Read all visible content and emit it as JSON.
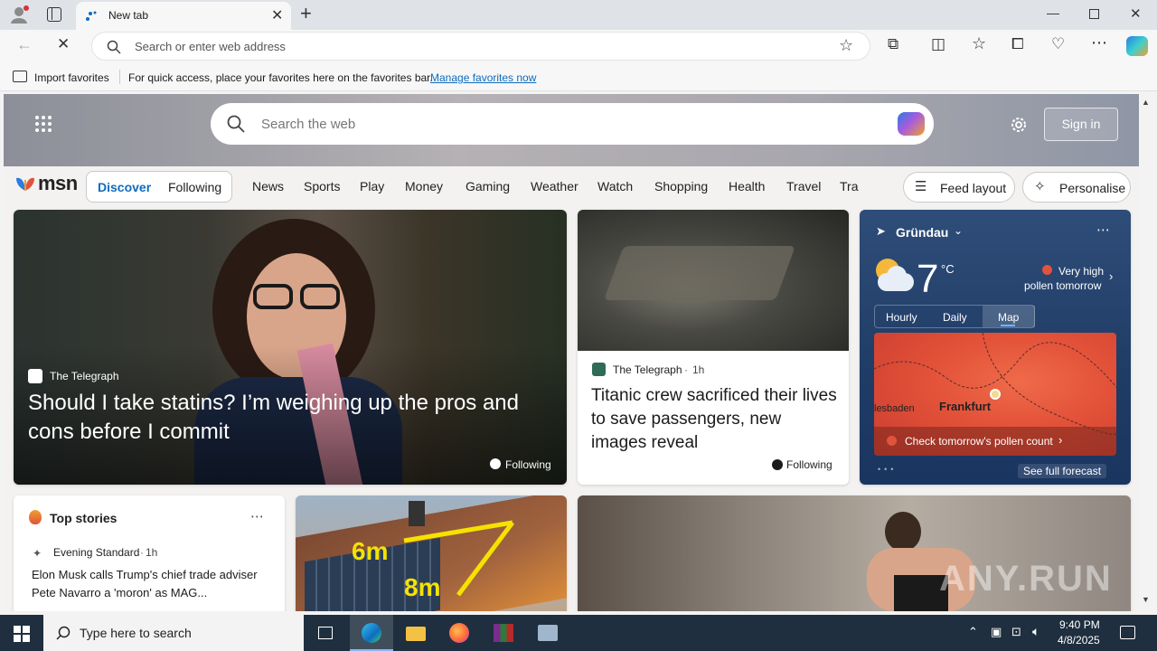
{
  "browser": {
    "tab_title": "New tab",
    "address_placeholder": "Search or enter web address",
    "favorites": {
      "import_label": "Import favorites",
      "hint": "For quick access, place your favorites here on the favorites bar.",
      "manage_link": "Manage favorites now"
    }
  },
  "msn": {
    "search_placeholder": "Search the web",
    "sign_in": "Sign in",
    "logo": "msn",
    "tabs": [
      "Discover",
      "Following"
    ],
    "nav": [
      "News",
      "Sports",
      "Play",
      "Money",
      "Gaming",
      "Weather",
      "Watch",
      "Shopping",
      "Health",
      "Travel",
      "Tra"
    ],
    "feed_layout": "Feed layout",
    "personalise": "Personalise"
  },
  "hero": {
    "source": "The Telegraph",
    "title": "Should I take statins? I’m weighing up the pros and cons before I commit",
    "following": "Following"
  },
  "titanic": {
    "source": "The Telegraph",
    "time": "1h",
    "title": "Titanic crew sacrificed their lives to save passengers, new images reveal",
    "following": "Following"
  },
  "weather": {
    "location": "Gründau",
    "temp": "7",
    "unit": "°C",
    "pollen_line1": "Very high",
    "pollen_line2": "pollen tomorrow",
    "tabs": [
      "Hourly",
      "Daily",
      "Map"
    ],
    "map_labels": [
      "lesbaden",
      "Frankfurt"
    ],
    "pollen_cta": "Check tomorrow's pollen count",
    "see_forecast": "See full forecast"
  },
  "top_stories": {
    "heading": "Top stories",
    "source": "Evening Standard",
    "time": "1h",
    "headline": "Elon Musk calls Trump's chief trade adviser Pete Navarro a 'moron' as MAG..."
  },
  "solar_card": {
    "label1": "6m",
    "label2": "8m"
  },
  "watermark": "ANY.RUN",
  "taskbar": {
    "search_placeholder": "Type here to search",
    "time": "9:40 PM",
    "date": "4/8/2025"
  },
  "colors": {
    "accent": "#0f6cbd",
    "taskbar": "#1f2f3f",
    "pollen_red": "#e0533c"
  }
}
